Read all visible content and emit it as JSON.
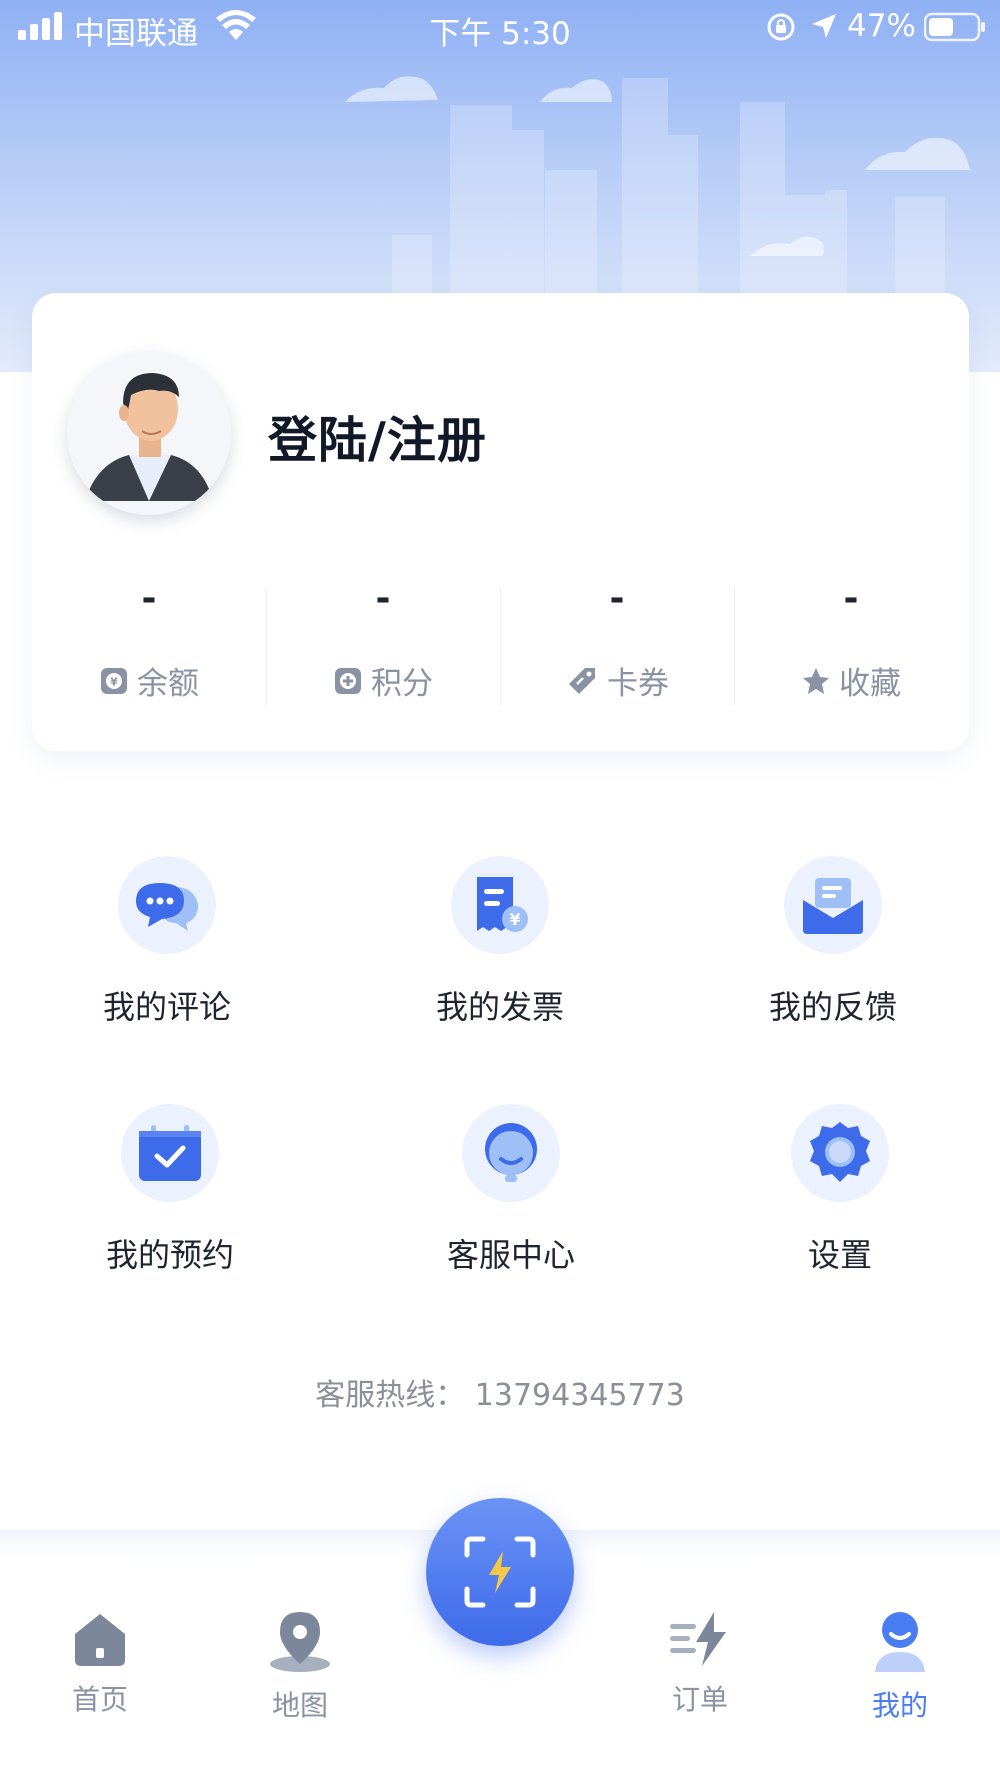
{
  "status_bar": {
    "carrier": "中国联通",
    "time": "下午 5:30",
    "battery": "47%"
  },
  "profile": {
    "login_label": "登陆/注册",
    "stats": [
      {
        "value": "-",
        "label": "余额",
        "icon": "wallet-icon"
      },
      {
        "value": "-",
        "label": "积分",
        "icon": "points-icon"
      },
      {
        "value": "-",
        "label": "卡券",
        "icon": "coupon-icon"
      },
      {
        "value": "-",
        "label": "收藏",
        "icon": "star-icon"
      }
    ]
  },
  "menu": [
    {
      "label": "我的评论",
      "icon": "comment-icon"
    },
    {
      "label": "我的发票",
      "icon": "invoice-icon"
    },
    {
      "label": "我的反馈",
      "icon": "feedback-icon"
    },
    {
      "label": "我的预约",
      "icon": "calendar-icon"
    },
    {
      "label": "客服中心",
      "icon": "customer-service-icon"
    },
    {
      "label": "设置",
      "icon": "settings-icon"
    }
  ],
  "hotline": "客服热线： 13794345773",
  "tabbar": {
    "items": [
      {
        "label": "首页",
        "icon": "home-icon"
      },
      {
        "label": "地图",
        "icon": "map-pin-icon"
      },
      {
        "label": "订单",
        "icon": "order-icon"
      },
      {
        "label": "我的",
        "icon": "profile-icon"
      }
    ],
    "active": "我的",
    "center_icon": "scan-charge-icon"
  },
  "colors": {
    "accent": "#4a7cf2",
    "icon_bg": "#ebf1fd",
    "muted_text": "#8a93a3",
    "hero_top": "#8fb0f4"
  }
}
